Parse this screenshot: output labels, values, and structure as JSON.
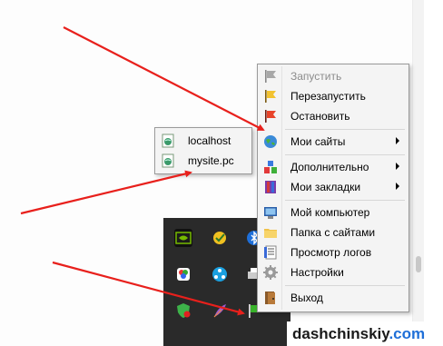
{
  "menu": {
    "items": [
      {
        "label": "Запустить",
        "icon": "flag-gray-icon",
        "disabled": true
      },
      {
        "label": "Перезапустить",
        "icon": "flag-yellow-icon"
      },
      {
        "label": "Остановить",
        "icon": "flag-red-icon"
      },
      {
        "label": "Мои сайты",
        "icon": "globe-icon",
        "submenu": true
      },
      {
        "label": "Дополнительно",
        "icon": "blocks-icon",
        "submenu": true
      },
      {
        "label": "Мои закладки",
        "icon": "bookmarks-icon",
        "submenu": true
      },
      {
        "label": "Мой компьютер",
        "icon": "computer-icon"
      },
      {
        "label": "Папка с сайтами",
        "icon": "folder-icon"
      },
      {
        "label": "Просмотр логов",
        "icon": "log-icon"
      },
      {
        "label": "Настройки",
        "icon": "gear-icon"
      },
      {
        "label": "Выход",
        "icon": "door-icon"
      }
    ]
  },
  "submenu": {
    "items": [
      {
        "label": "localhost",
        "icon": "site-icon"
      },
      {
        "label": "mysite.pc",
        "icon": "site-icon"
      }
    ]
  },
  "tray": {
    "icons": [
      "nvidia-icon",
      "checkmark-app-icon",
      "bluetooth-icon",
      "color-palette-icon",
      "network-share-icon",
      "printer-icon",
      "shield-icon",
      "feather-icon",
      "openserver-flag-icon"
    ]
  },
  "watermark": {
    "domain": "dashchinskiy",
    "tld": ".com"
  },
  "colors": {
    "arrow": "#e8201c",
    "menu_bg": "#f4f4f4",
    "tray_bg": "#2a2a2a"
  }
}
